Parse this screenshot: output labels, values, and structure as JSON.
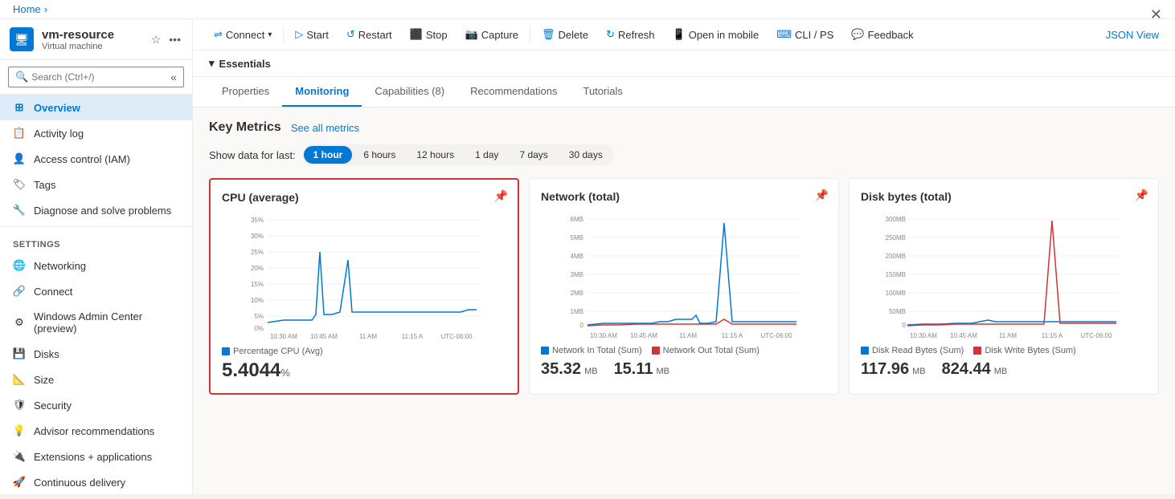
{
  "breadcrumb": {
    "home": "Home",
    "separator": "›"
  },
  "vm": {
    "name": "vm-resource",
    "type": "Virtual machine",
    "icon": "🖥"
  },
  "toolbar": {
    "connect_label": "Connect",
    "start_label": "Start",
    "restart_label": "Restart",
    "stop_label": "Stop",
    "capture_label": "Capture",
    "delete_label": "Delete",
    "refresh_label": "Refresh",
    "open_mobile_label": "Open in mobile",
    "cli_ps_label": "CLI / PS",
    "feedback_label": "Feedback",
    "json_view_label": "JSON View"
  },
  "search": {
    "placeholder": "Search (Ctrl+/)"
  },
  "sidebar": {
    "nav_items": [
      {
        "id": "overview",
        "label": "Overview",
        "active": true,
        "icon": "⊞"
      },
      {
        "id": "activity-log",
        "label": "Activity log",
        "active": false,
        "icon": "📋"
      },
      {
        "id": "access-control",
        "label": "Access control (IAM)",
        "active": false,
        "icon": "👤"
      },
      {
        "id": "tags",
        "label": "Tags",
        "active": false,
        "icon": "🏷"
      },
      {
        "id": "diagnose",
        "label": "Diagnose and solve problems",
        "active": false,
        "icon": "🔧"
      }
    ],
    "settings_label": "Settings",
    "settings_items": [
      {
        "id": "networking",
        "label": "Networking",
        "icon": "🌐"
      },
      {
        "id": "connect",
        "label": "Connect",
        "icon": "🔗"
      },
      {
        "id": "windows-admin",
        "label": "Windows Admin Center (preview)",
        "icon": "⚙"
      },
      {
        "id": "disks",
        "label": "Disks",
        "icon": "💾"
      },
      {
        "id": "size",
        "label": "Size",
        "icon": "📐"
      },
      {
        "id": "security",
        "label": "Security",
        "icon": "🛡"
      },
      {
        "id": "advisor",
        "label": "Advisor recommendations",
        "icon": "💡"
      },
      {
        "id": "extensions",
        "label": "Extensions + applications",
        "icon": "🔌"
      },
      {
        "id": "continuous",
        "label": "Continuous delivery",
        "icon": "🚀"
      }
    ]
  },
  "essentials": {
    "label": "Essentials"
  },
  "tabs": [
    {
      "id": "properties",
      "label": "Properties",
      "active": false
    },
    {
      "id": "monitoring",
      "label": "Monitoring",
      "active": true
    },
    {
      "id": "capabilities",
      "label": "Capabilities (8)",
      "active": false
    },
    {
      "id": "recommendations",
      "label": "Recommendations",
      "active": false
    },
    {
      "id": "tutorials",
      "label": "Tutorials",
      "active": false
    }
  ],
  "monitoring": {
    "key_metrics_label": "Key Metrics",
    "see_metrics_label": "See all metrics",
    "show_data_label": "Show data for last:",
    "time_options": [
      {
        "id": "1h",
        "label": "1 hour",
        "active": true
      },
      {
        "id": "6h",
        "label": "6 hours",
        "active": false
      },
      {
        "id": "12h",
        "label": "12 hours",
        "active": false
      },
      {
        "id": "1d",
        "label": "1 day",
        "active": false
      },
      {
        "id": "7d",
        "label": "7 days",
        "active": false
      },
      {
        "id": "30d",
        "label": "30 days",
        "active": false
      }
    ],
    "charts": [
      {
        "id": "cpu",
        "title": "CPU (average)",
        "selected": true,
        "legend": [
          {
            "label": "Percentage CPU (Avg)",
            "color": "#0078d4"
          }
        ],
        "value": "5.4044",
        "unit": "%",
        "x_labels": [
          "10:30 AM",
          "10:45 AM",
          "11 AM",
          "11:15 A",
          "UTC-06:00"
        ],
        "y_labels": [
          "35%",
          "30%",
          "25%",
          "20%",
          "15%",
          "10%",
          "5%",
          "0%"
        ],
        "values_row": null,
        "chart_type": "cpu"
      },
      {
        "id": "network",
        "title": "Network (total)",
        "selected": false,
        "legend": [
          {
            "label": "Network In Total (Sum)",
            "color": "#0078d4"
          },
          {
            "label": "Network Out Total (Sum)",
            "color": "#d13438"
          }
        ],
        "value": null,
        "unit": "",
        "x_labels": [
          "10:30 AM",
          "10:45 AM",
          "11 AM",
          "11:15 A",
          "UTC-06:00"
        ],
        "y_labels": [
          "6MB",
          "5MB",
          "4MB",
          "3MB",
          "2MB",
          "1MB",
          "0"
        ],
        "values_row": [
          {
            "num": "35.32",
            "unit": "MB"
          },
          {
            "num": "15.11",
            "unit": "MB"
          }
        ],
        "chart_type": "network"
      },
      {
        "id": "disk",
        "title": "Disk bytes (total)",
        "selected": false,
        "legend": [
          {
            "label": "Disk Read Bytes (Sum)",
            "color": "#0078d4"
          },
          {
            "label": "Disk Write Bytes (Sum)",
            "color": "#d13438"
          }
        ],
        "value": null,
        "unit": "",
        "x_labels": [
          "10:30 AM",
          "10:45 AM",
          "11 AM",
          "11:15 A",
          "UTC-06:00"
        ],
        "y_labels": [
          "300MB",
          "250MB",
          "200MB",
          "150MB",
          "100MB",
          "50MB",
          "0"
        ],
        "values_row": [
          {
            "num": "117.96",
            "unit": "MB"
          },
          {
            "num": "824.44",
            "unit": "MB"
          }
        ],
        "chart_type": "disk"
      }
    ]
  }
}
